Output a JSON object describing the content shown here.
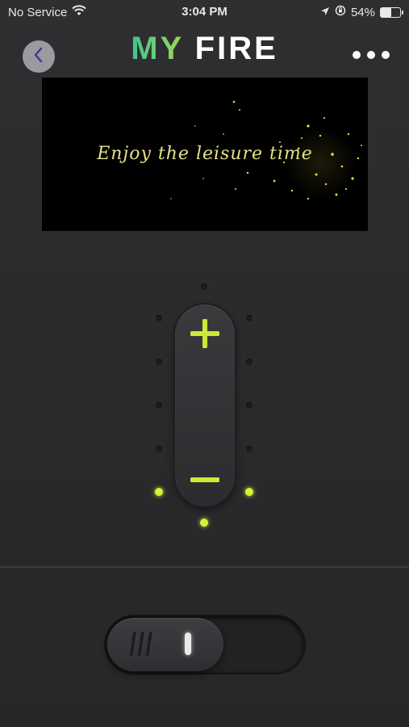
{
  "status_bar": {
    "carrier": "No Service",
    "time": "3:04 PM",
    "battery": "54%",
    "battery_level": 0.54,
    "icons": [
      "wifi-icon",
      "location-arrow-icon",
      "screen-lock-rotation-icon",
      "battery-icon"
    ]
  },
  "header": {
    "title_part1": "MY",
    "title_part2": "FIRE",
    "back_icon": "chevron-left-icon",
    "more_icon": "more-dots-icon"
  },
  "preview": {
    "caption": "Enjoy the leisure time"
  },
  "flame_control": {
    "plus_icon": "plus-icon",
    "minus_icon": "minus-icon",
    "level": 1,
    "max_level": 6
  },
  "toggle": {
    "state": "on"
  },
  "colors": {
    "accent": "#d6f03a",
    "title_gradient_start": "#3fc38e",
    "title_gradient_end": "#9fd85a",
    "background": "#2b2b2d"
  }
}
